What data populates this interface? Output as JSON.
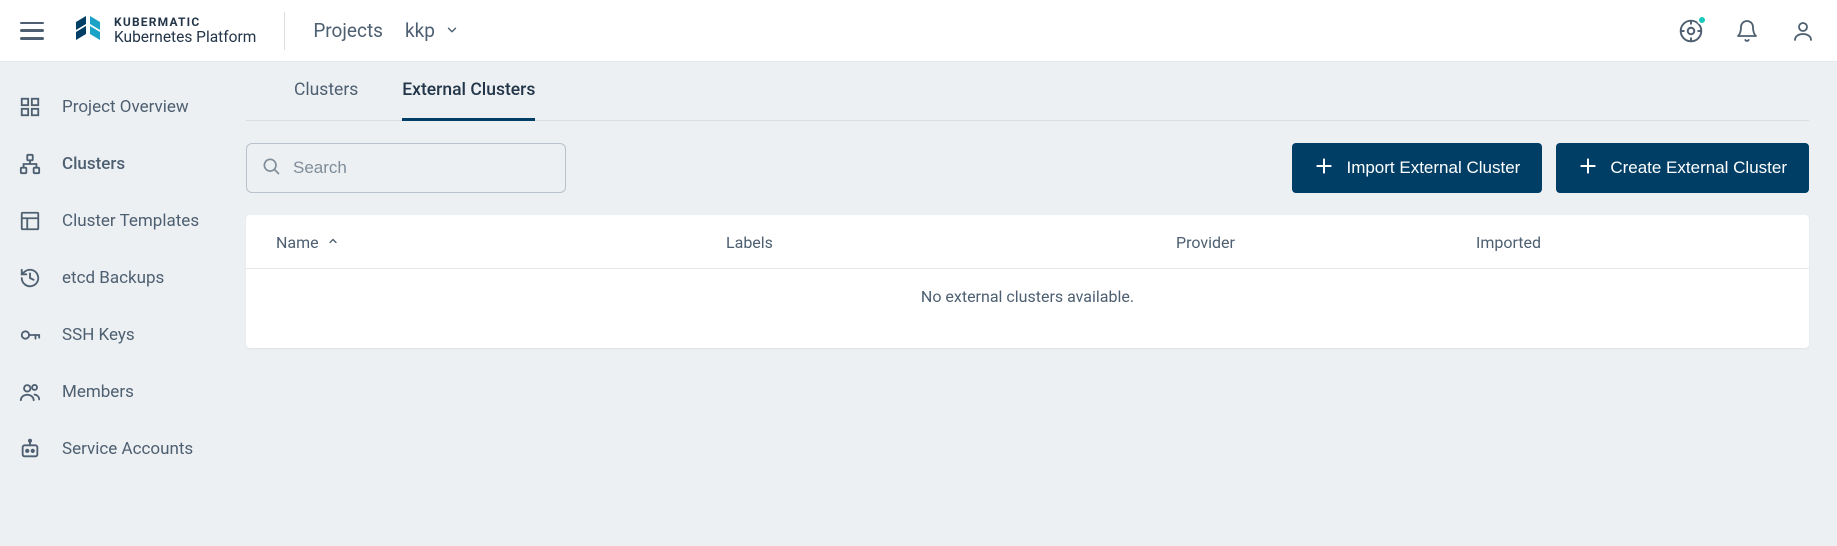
{
  "brand": {
    "line1": "KUBERMATIC",
    "line2": "Kubernetes Platform"
  },
  "breadcrumb": {
    "projects": "Projects",
    "current": "kkp"
  },
  "sidebar": {
    "items": [
      {
        "label": "Project Overview"
      },
      {
        "label": "Clusters"
      },
      {
        "label": "Cluster Templates"
      },
      {
        "label": "etcd Backups"
      },
      {
        "label": "SSH Keys"
      },
      {
        "label": "Members"
      },
      {
        "label": "Service Accounts"
      }
    ]
  },
  "tabs": {
    "clusters": "Clusters",
    "external": "External Clusters"
  },
  "search": {
    "placeholder": "Search"
  },
  "buttons": {
    "import": "Import External Cluster",
    "create": "Create External Cluster"
  },
  "table": {
    "columns": {
      "name": "Name",
      "labels": "Labels",
      "provider": "Provider",
      "imported": "Imported"
    },
    "empty": "No external clusters available."
  },
  "colors": {
    "primary": "#003e66",
    "accent": "#1bc8bc"
  }
}
